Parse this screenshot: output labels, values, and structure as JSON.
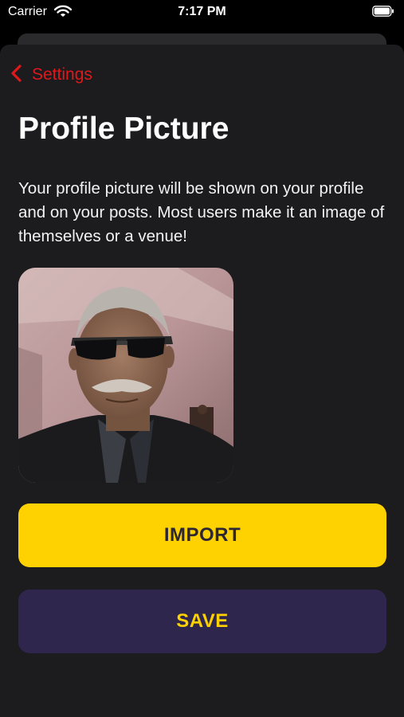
{
  "status_bar": {
    "carrier": "Carrier",
    "time": "7:17 PM",
    "wifi_icon": "wifi-icon",
    "battery_icon": "battery-icon"
  },
  "nav": {
    "back_label": "Settings",
    "back_icon": "chevron-left-icon"
  },
  "page": {
    "title": "Profile Picture",
    "description": "Your profile picture will be shown on your profile and on your posts.  Most users make it an image of themselves or a venue!"
  },
  "buttons": {
    "import_label": "IMPORT",
    "save_label": "SAVE"
  },
  "colors": {
    "background": "#1c1c1e",
    "accent_red": "#e0181b",
    "import_bg": "#fdd200",
    "import_text": "#2d2633",
    "save_bg": "#2e264d",
    "save_text": "#fdd200"
  }
}
